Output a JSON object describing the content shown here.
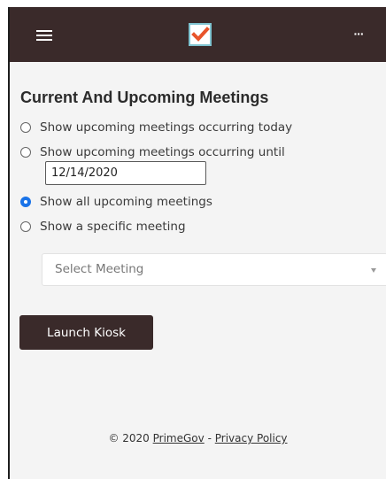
{
  "header": {
    "menu_icon": "hamburger-menu-icon",
    "logo_icon": "checkbox-logo-icon",
    "more_icon": "ellipsis-icon",
    "more_label": "···",
    "colors": {
      "bar_background": "#3a2a2a",
      "logo_check": "#e8542a",
      "logo_frame": "#7fc3d0"
    }
  },
  "main": {
    "heading": "Current And Upcoming Meetings",
    "options": [
      {
        "label": "Show upcoming meetings occurring today",
        "checked": false
      },
      {
        "label": "Show upcoming meetings occurring until",
        "checked": false
      },
      {
        "label": "Show all upcoming meetings",
        "checked": true
      },
      {
        "label": "Show a specific meeting",
        "checked": false
      }
    ],
    "date_value": "12/14/2020",
    "select_placeholder": "Select Meeting",
    "launch_button": "Launch Kiosk"
  },
  "footer": {
    "copyright": "© 2020",
    "brand_link": "PrimeGov",
    "separator": "-",
    "privacy_link": "Privacy Policy"
  }
}
